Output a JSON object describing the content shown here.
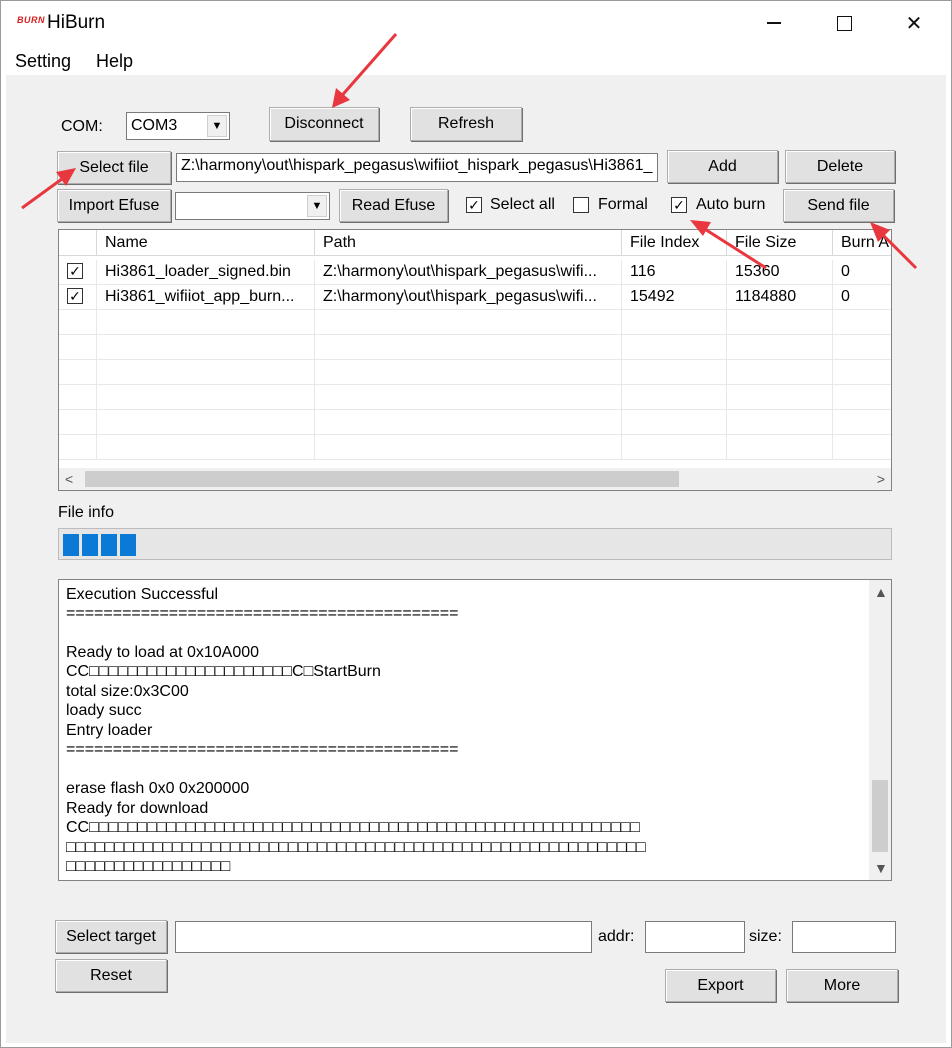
{
  "window": {
    "logo_text": "BURN",
    "title": "HiBurn"
  },
  "menu": {
    "items": [
      "Setting",
      "Help"
    ]
  },
  "top": {
    "com_label": "COM:",
    "com_value": "COM3",
    "disconnect_label": "Disconnect",
    "refresh_label": "Refresh",
    "select_file_label": "Select file",
    "file_path": "Z:\\harmony\\out\\hispark_pegasus\\wifiiot_hispark_pegasus\\Hi3861_",
    "add_label": "Add",
    "delete_label": "Delete",
    "import_efuse_label": "Import Efuse",
    "efuse_value": "",
    "read_efuse_label": "Read Efuse",
    "select_all_label": "Select all",
    "select_all_checked": true,
    "formal_label": "Formal",
    "formal_checked": false,
    "auto_burn_label": "Auto burn",
    "auto_burn_checked": true,
    "send_file_label": "Send file"
  },
  "file_table": {
    "columns": [
      "Name",
      "Path",
      "File Index",
      "File Size",
      "Burn A"
    ],
    "rows": [
      {
        "checked": true,
        "name": "Hi3861_loader_signed.bin",
        "path": "Z:\\harmony\\out\\hispark_pegasus\\wifi...",
        "file_index": "116",
        "file_size": "15360",
        "burn": "0"
      },
      {
        "checked": true,
        "name": "Hi3861_wifiiot_app_burn...",
        "path": "Z:\\harmony\\out\\hispark_pegasus\\wifi...",
        "file_index": "15492",
        "file_size": "1184880",
        "burn": "0"
      }
    ]
  },
  "file_info": {
    "label": "File info",
    "progress_blocks": 4
  },
  "log": {
    "lines": [
      "Execution Successful",
      "==========================================",
      "",
      "Ready to load at 0x10A000",
      "CC□□□□□□□□□□□□□□□□□□□□□C□StartBurn",
      "total size:0x3C00",
      "loady succ",
      "Entry loader",
      "==========================================",
      "",
      "erase flash 0x0 0x200000",
      "Ready for download",
      "CC□□□□□□□□□□□□□□□□□□□□□□□□□□□□□□□□□□□□□□□□□□□□□□□□□□□□□□□□□",
      "□□□□□□□□□□□□□□□□□□□□□□□□□□□□□□□□□□□□□□□□□□□□□□□□□□□□□□□□□□□□",
      "□□□□□□□□□□□□□□□□□"
    ]
  },
  "bottom": {
    "select_target_label": "Select target",
    "target_value": "",
    "addr_label": "addr:",
    "addr_value": "",
    "size_label": "size:",
    "size_value": "",
    "reset_label": "Reset",
    "export_label": "Export",
    "more_label": "More"
  },
  "colors": {
    "progress": "#0a7ad6",
    "annotation_arrow": "#e8373e"
  }
}
